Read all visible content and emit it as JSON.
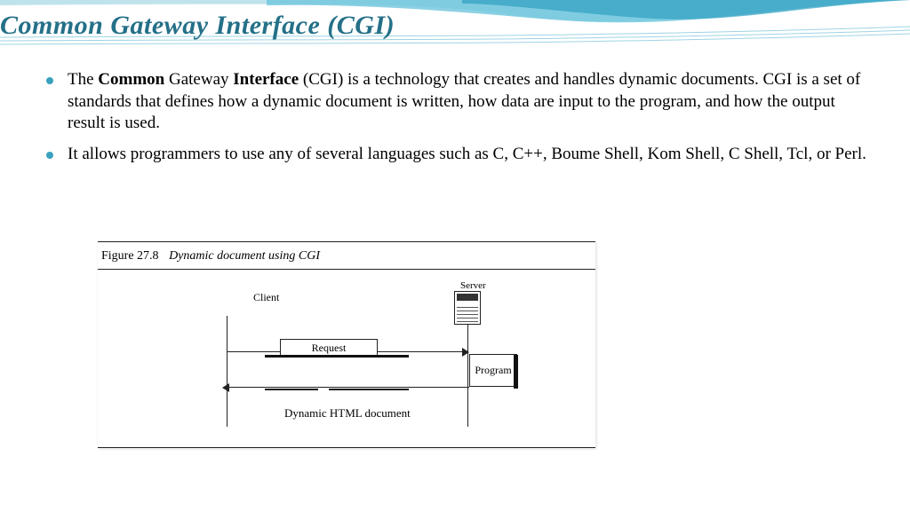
{
  "title": "Common Gateway Interface (CGI)",
  "bullets": [
    {
      "pre": "The ",
      "bold1": "Common",
      "mid1": " Gateway ",
      "bold2": "Interface",
      "rest": " (CGI) is a technology that creates and handles dynamic documents. CGI is a set of standards that defines how a dynamic document is written, how data are input to the program, and how the output result is used."
    },
    {
      "text": "It  allows programmers to use any of several languages such as C, C++, Boume Shell, Kom Shell, C Shell, Tcl, or Perl."
    }
  ],
  "figure": {
    "label": "Figure 27.8",
    "desc": "Dynamic document using CGI",
    "client": "Client",
    "server": "Server",
    "request": "Request",
    "program": "Program",
    "dynamic": "Dynamic HTML document"
  }
}
